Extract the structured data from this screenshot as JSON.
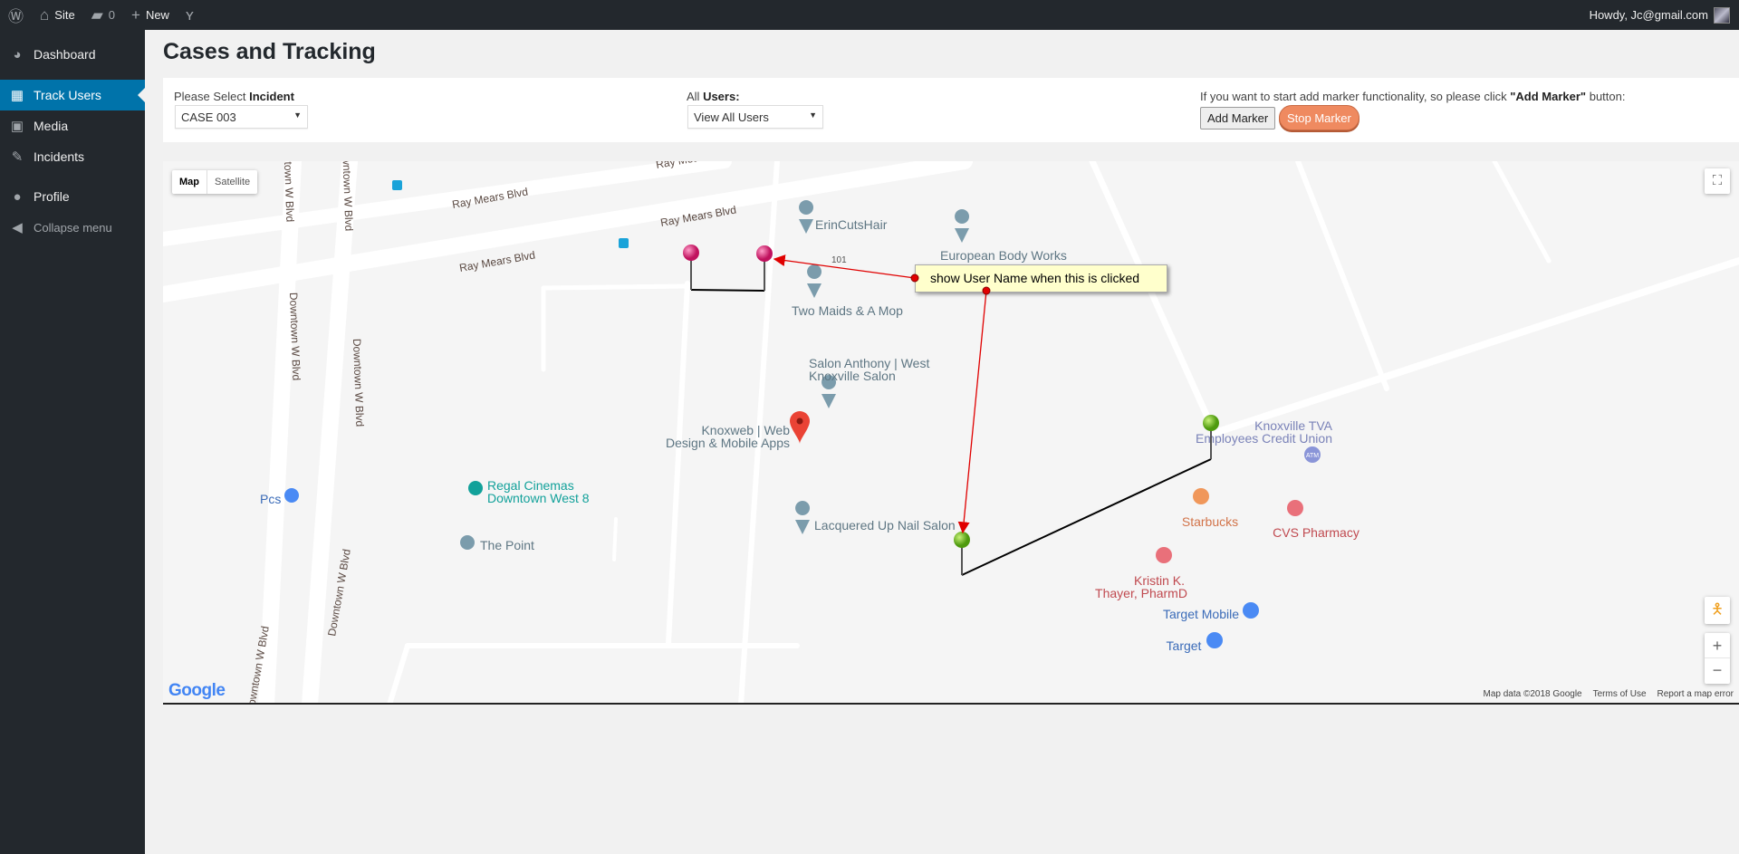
{
  "topbar": {
    "site": "Site",
    "comments": "0",
    "new": "New",
    "howdy": "Howdy, Jc@gmail.com"
  },
  "sidebar": {
    "items": [
      {
        "label": "Dashboard"
      },
      {
        "label": "Track Users"
      },
      {
        "label": "Media"
      },
      {
        "label": "Incidents"
      },
      {
        "label": "Profile"
      },
      {
        "label": "Collapse menu"
      }
    ]
  },
  "page": {
    "title": "Cases and Tracking"
  },
  "filters": {
    "incident_label_prefix": "Please Select ",
    "incident_label_bold": "Incident",
    "incident_value": "CASE 003",
    "users_label": "All ",
    "users_label_bold": "Users:",
    "users_value": "View All Users",
    "marker_hint_pre": "If you want to start add marker functionality, so please click ",
    "marker_hint_bold": "\"Add Marker\"",
    "marker_hint_post": " button:",
    "add_marker": "Add Marker",
    "stop_marker": "Stop Marker"
  },
  "map": {
    "type_map": "Map",
    "type_satellite": "Satellite",
    "tooltip": "show User Name when this is clicked",
    "route_label": "101",
    "streets": [
      "Ray Mears Blvd",
      "Ray Mears Blvd",
      "Ray Mears Blvd",
      "Ray Mears Blvd",
      "Downtown W Blvd",
      "Downtown W Blvd",
      "Downtown W Blvd",
      "Downtown W Blvd",
      "Downtown W Blvd",
      "Downtown W Blvd"
    ],
    "places": [
      "ErinCutsHair",
      "European Body Works",
      "Two Maids & A Mop",
      "Salon Anthony | West",
      "Knoxville Salon",
      "Knoxweb | Web",
      "Design & Mobile Apps",
      "Regal Cinemas",
      "Downtown West 8",
      "The Point",
      "Pcs",
      "Lacquered Up Nail Salon",
      "Knoxville TVA",
      "Employees Credit Union",
      "Starbucks",
      "CVS Pharmacy",
      "Kristin K.",
      "Thayer, PharmD",
      "Target Mobile",
      "Target"
    ],
    "logo": "Google",
    "atm": "ATM",
    "footer": {
      "data": "Map data ©2018 Google",
      "terms": "Terms of Use",
      "report": "Report a map error"
    },
    "colors": {
      "pink_pin": "#d6216f",
      "green_pin": "#6fba1a",
      "tooltip_bg": "#ffffcc",
      "arrow": "#e00000"
    }
  }
}
